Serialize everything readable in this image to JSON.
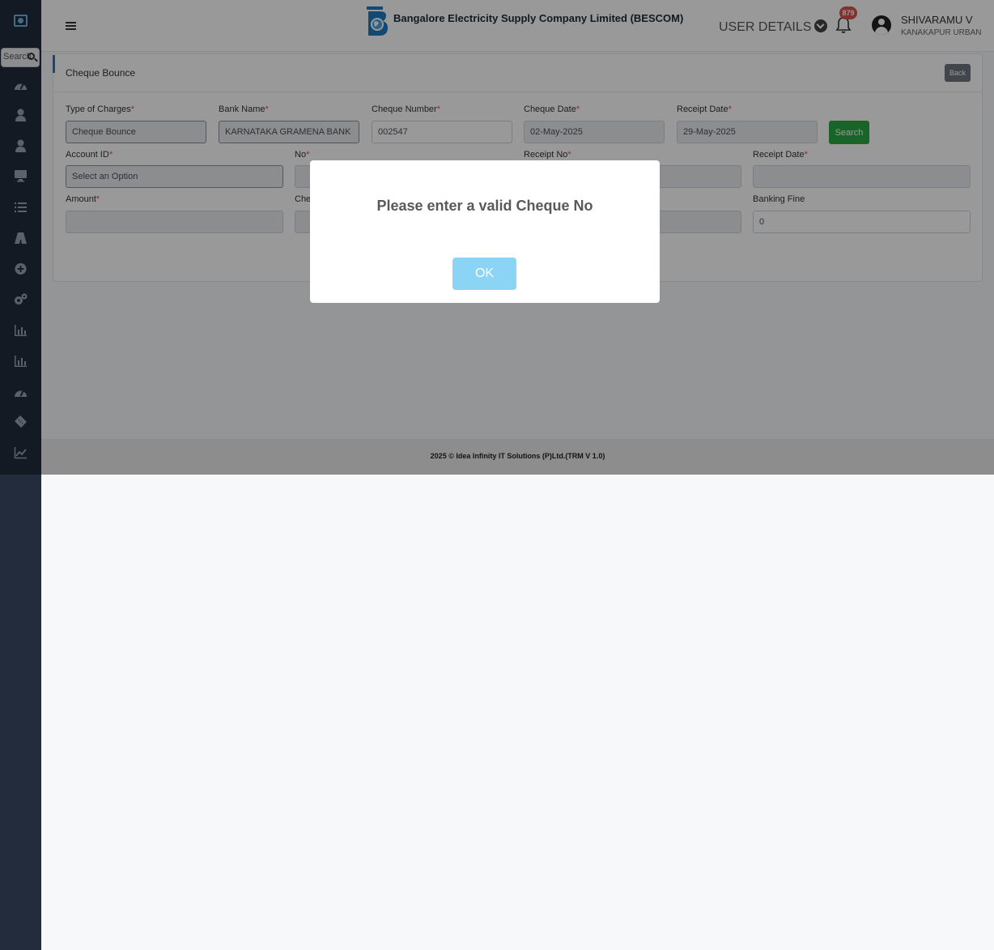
{
  "sidebar": {
    "search_label": "Search",
    "icons": [
      "dashboard-icon",
      "user-icon",
      "user-icon-2",
      "monitor-icon",
      "list-icon",
      "road-icon",
      "plus-circle-icon",
      "gears-icon",
      "bar-chart-icon",
      "bar-chart-icon-2",
      "dashboard-icon-2",
      "ticket-icon",
      "line-chart-icon"
    ]
  },
  "header": {
    "brand": "Bangalore Electricity Supply Company Limited (BESCOM)",
    "user_details": "USER DETAILS",
    "notification_count": "879",
    "user_name": "SHIVARAMU V",
    "user_location": "KANAKAPUR URBAN"
  },
  "card": {
    "title": "Cheque Bounce",
    "back_label": "Back"
  },
  "form": {
    "type_of_charges": {
      "label": "Type of Charges",
      "value": "Cheque Bounce"
    },
    "bank_name": {
      "label": "Bank Name",
      "value": "KARNATAKA GRAMENA BANK"
    },
    "cheque_number": {
      "label": "Cheque Number",
      "value": "002547"
    },
    "cheque_date": {
      "label": "Cheque Date",
      "value": "02-May-2025"
    },
    "receipt_date": {
      "label": "Receipt Date",
      "value": "29-May-2025"
    },
    "search_label": "Search",
    "account_id": {
      "label": "Account ID",
      "value": "Select an Option"
    },
    "no_label": "No",
    "receipt_no_label": "Receipt No",
    "receipt_date_2_label": "Receipt Date",
    "amount_label": "Amount",
    "cheque_label_partial": "Che",
    "banking_fine": {
      "label": "Banking Fine",
      "value": "0"
    },
    "required_mark": "*"
  },
  "footer": {
    "text": "2025 © Idea Infinity IT Solutions (P)Ltd.(TRM V 1.0)"
  },
  "modal": {
    "message": "Please enter a valid Cheque No",
    "ok_label": "OK"
  },
  "colors": {
    "sidebar": "#222c3c",
    "accent": "#2f79b9",
    "search_button": "#28a745",
    "ok_button": "#8cd4f5",
    "badge": "#d9534f"
  }
}
